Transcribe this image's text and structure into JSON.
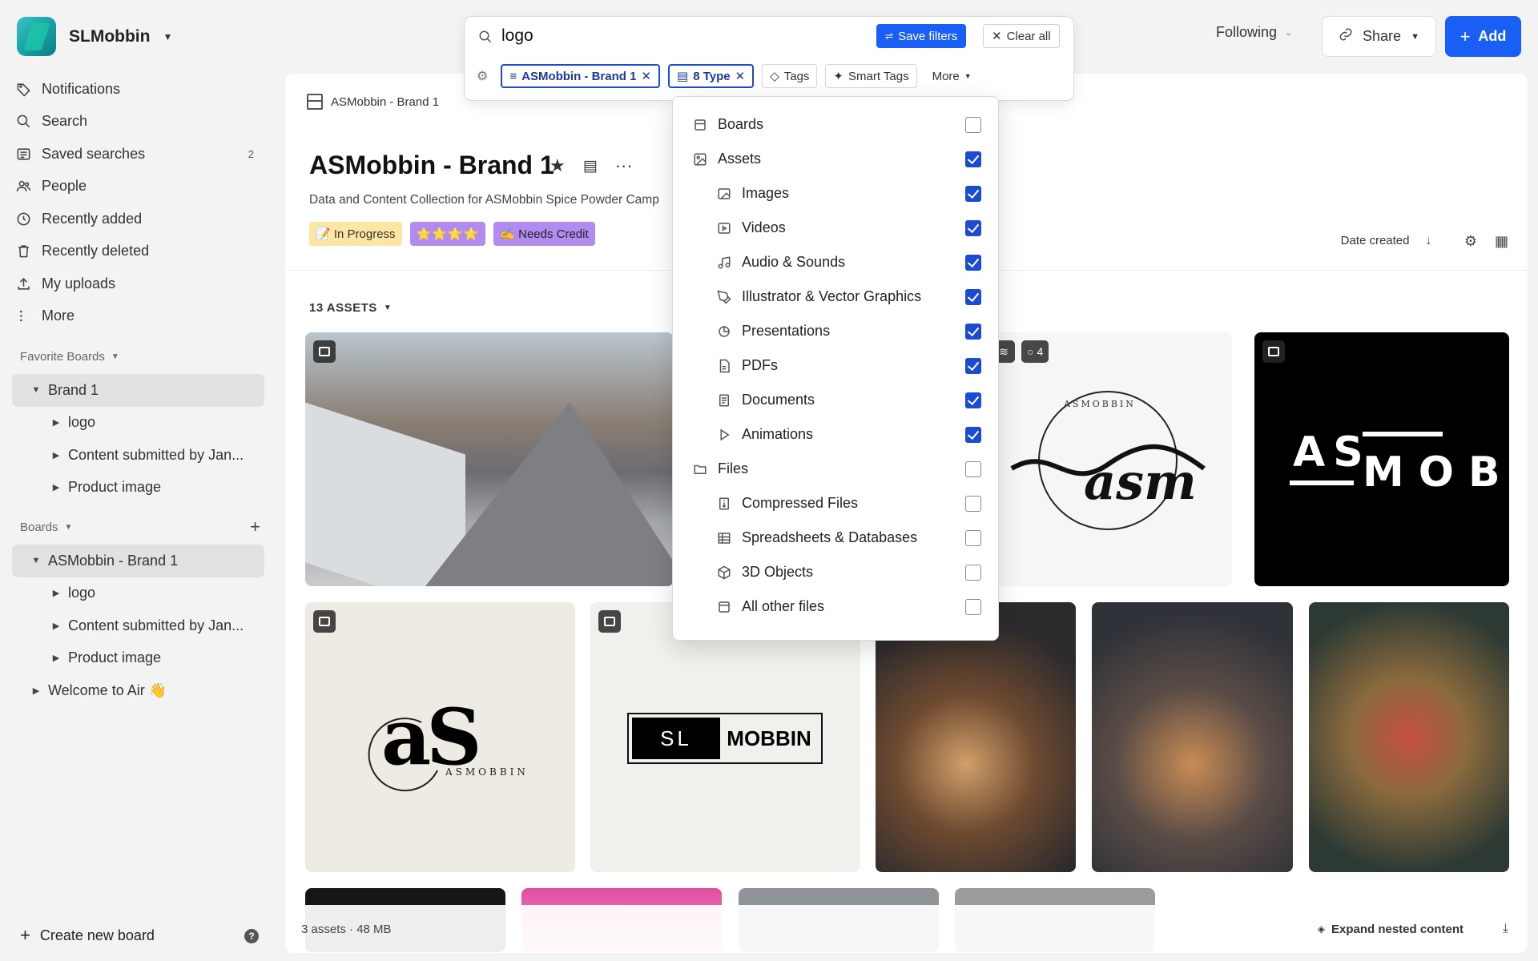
{
  "workspace": {
    "name": "SLMobbin"
  },
  "nav": [
    {
      "label": "Notifications",
      "icon": "tag-icon"
    },
    {
      "label": "Search",
      "icon": "search-icon"
    },
    {
      "label": "Saved searches",
      "icon": "saved-search-icon",
      "count": "2"
    },
    {
      "label": "People",
      "icon": "people-icon"
    },
    {
      "label": "Recently added",
      "icon": "clock-icon"
    },
    {
      "label": "Recently deleted",
      "icon": "trash-icon"
    },
    {
      "label": "My uploads",
      "icon": "upload-icon"
    },
    {
      "label": "More",
      "icon": "more-vertical-icon"
    }
  ],
  "favorite_boards": {
    "header": "Favorite Boards",
    "items": [
      {
        "label": "Brand 1"
      },
      {
        "label": "logo"
      },
      {
        "label": "Content submitted by Jan..."
      },
      {
        "label": "Product image"
      }
    ]
  },
  "boards": {
    "header": "Boards",
    "items": [
      {
        "label": "ASMobbin - Brand 1"
      },
      {
        "label": "logo"
      },
      {
        "label": "Content submitted by Jan..."
      },
      {
        "label": "Product image"
      },
      {
        "label": "Welcome to Air 👋"
      }
    ]
  },
  "sidebar_footer": {
    "create_label": "Create new board",
    "help": "?"
  },
  "topbar": {
    "following": "Following",
    "share": "Share",
    "add": "Add"
  },
  "search": {
    "query": "logo",
    "save_filters": "Save filters",
    "clear_all": "Clear all",
    "chips": [
      {
        "label": "ASMobbin - Brand 1",
        "active": true
      },
      {
        "label": "8 Type",
        "active": true
      },
      {
        "label": "Tags",
        "active": false
      },
      {
        "label": "Smart Tags",
        "active": false
      },
      {
        "label": "More",
        "active": false
      }
    ]
  },
  "type_filter": {
    "options": [
      {
        "label": "Boards",
        "level": 0,
        "checked": false,
        "icon": "boards-icon"
      },
      {
        "label": "Assets",
        "level": 0,
        "checked": true,
        "icon": "assets-icon"
      },
      {
        "label": "Images",
        "level": 1,
        "checked": true,
        "icon": "image-icon"
      },
      {
        "label": "Videos",
        "level": 1,
        "checked": true,
        "icon": "video-icon"
      },
      {
        "label": "Audio & Sounds",
        "level": 1,
        "checked": true,
        "icon": "music-icon"
      },
      {
        "label": "Illustrator & Vector Graphics",
        "level": 1,
        "checked": true,
        "icon": "pen-tool-icon"
      },
      {
        "label": "Presentations",
        "level": 1,
        "checked": true,
        "icon": "presentation-icon"
      },
      {
        "label": "PDFs",
        "level": 1,
        "checked": true,
        "icon": "pdf-icon"
      },
      {
        "label": "Documents",
        "level": 1,
        "checked": true,
        "icon": "document-icon"
      },
      {
        "label": "Animations",
        "level": 1,
        "checked": true,
        "icon": "play-icon"
      },
      {
        "label": "Files",
        "level": 0,
        "checked": false,
        "icon": "folder-icon"
      },
      {
        "label": "Compressed Files",
        "level": 1,
        "checked": false,
        "icon": "zip-icon"
      },
      {
        "label": "Spreadsheets & Databases",
        "level": 1,
        "checked": false,
        "icon": "table-icon"
      },
      {
        "label": "3D Objects",
        "level": 1,
        "checked": false,
        "icon": "cube-icon"
      },
      {
        "label": "All other files",
        "level": 1,
        "checked": false,
        "icon": "file-icon"
      }
    ]
  },
  "board": {
    "breadcrumb": "ASMobbin - Brand 1",
    "title": "ASMobbin - Brand 1",
    "description": "Data and Content Collection for ASMobbin Spice Powder Camp",
    "badges": [
      "📝 In Progress",
      "⭐⭐⭐⭐",
      "✍️ Needs Credit"
    ],
    "sort_label": "Date created",
    "asset_count": "13 ASSETS"
  },
  "tiles": {
    "comment_count": "4",
    "asm_ring_text": "ASMOBBIN",
    "asm_script": "asm",
    "black_line1": "AS",
    "black_line2": "MOB",
    "beige_big": "aS",
    "beige_small": "ASMOBBIN",
    "mobbin_left": "SL",
    "mobbin_right": "MOBBIN"
  },
  "status_bar": {
    "summary": "3 assets · 48 MB",
    "expand": "Expand nested content"
  }
}
